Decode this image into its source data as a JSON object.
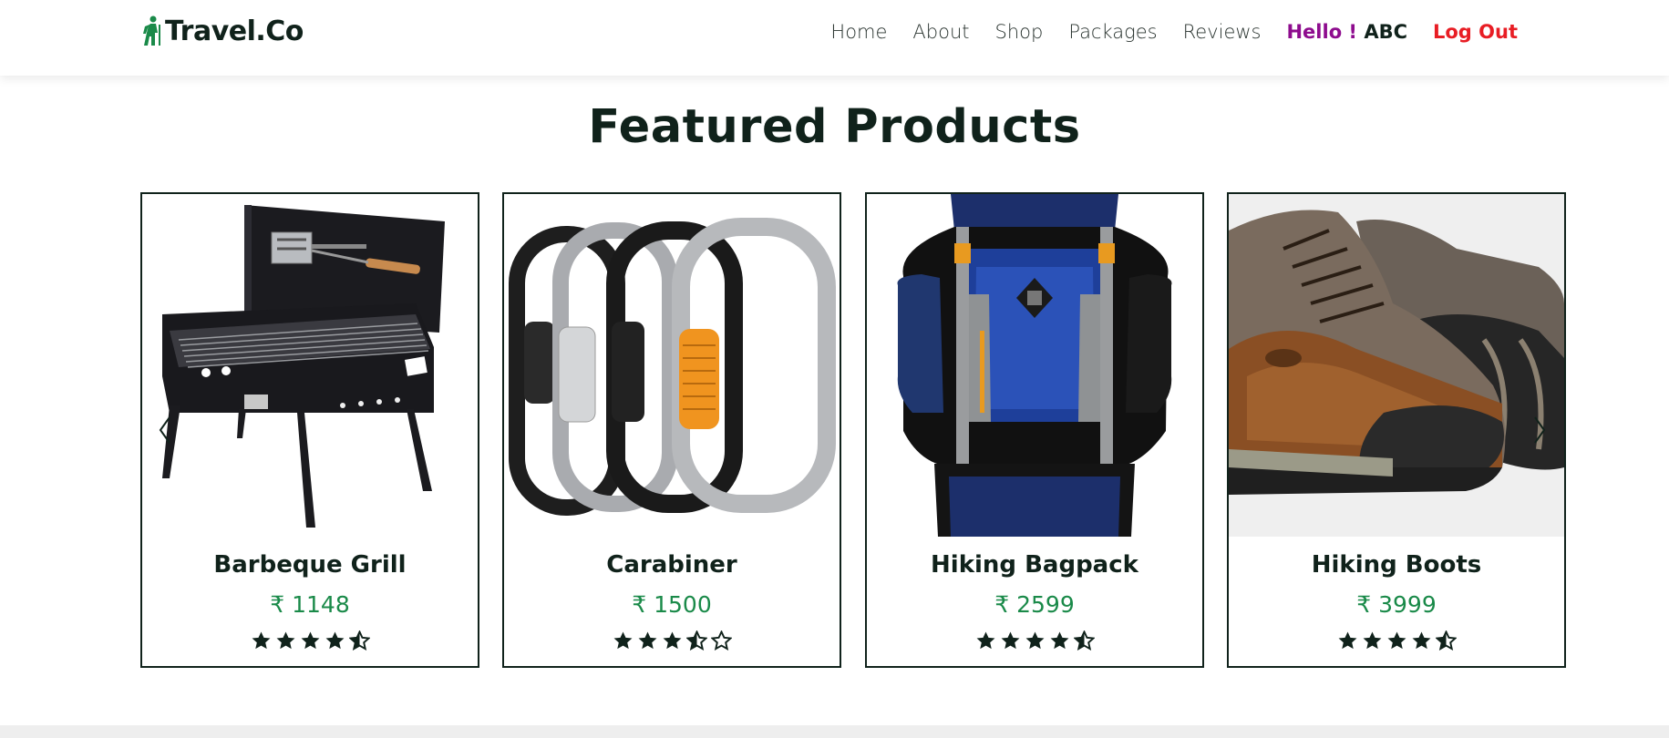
{
  "brand": {
    "name": "Travel.Co",
    "icon": "hiker-icon",
    "color": "#1a8a49"
  },
  "nav": {
    "items": [
      "Home",
      "About",
      "Shop",
      "Packages",
      "Reviews"
    ],
    "hello_prefix": "Hello !",
    "hello_user": "ABC",
    "logout": "Log Out"
  },
  "section": {
    "title": "Featured Products"
  },
  "products": [
    {
      "name": "Barbeque Grill",
      "price": "₹ 1148",
      "rating": 4.5,
      "image": "barbeque-grill-image"
    },
    {
      "name": "Carabiner",
      "price": "₹ 1500",
      "rating": 3.5,
      "image": "carabiner-image"
    },
    {
      "name": "Hiking Bagpack",
      "price": "₹ 2599",
      "rating": 4.5,
      "image": "hiking-bagpack-image"
    },
    {
      "name": "Hiking Boots",
      "price": "₹ 3999",
      "rating": 4.5,
      "image": "hiking-boots-image"
    }
  ],
  "colors": {
    "accent_green": "#1a8a49",
    "dark": "#10221b",
    "hello_purple": "#8e0c8e",
    "logout_red": "#e81d24"
  }
}
